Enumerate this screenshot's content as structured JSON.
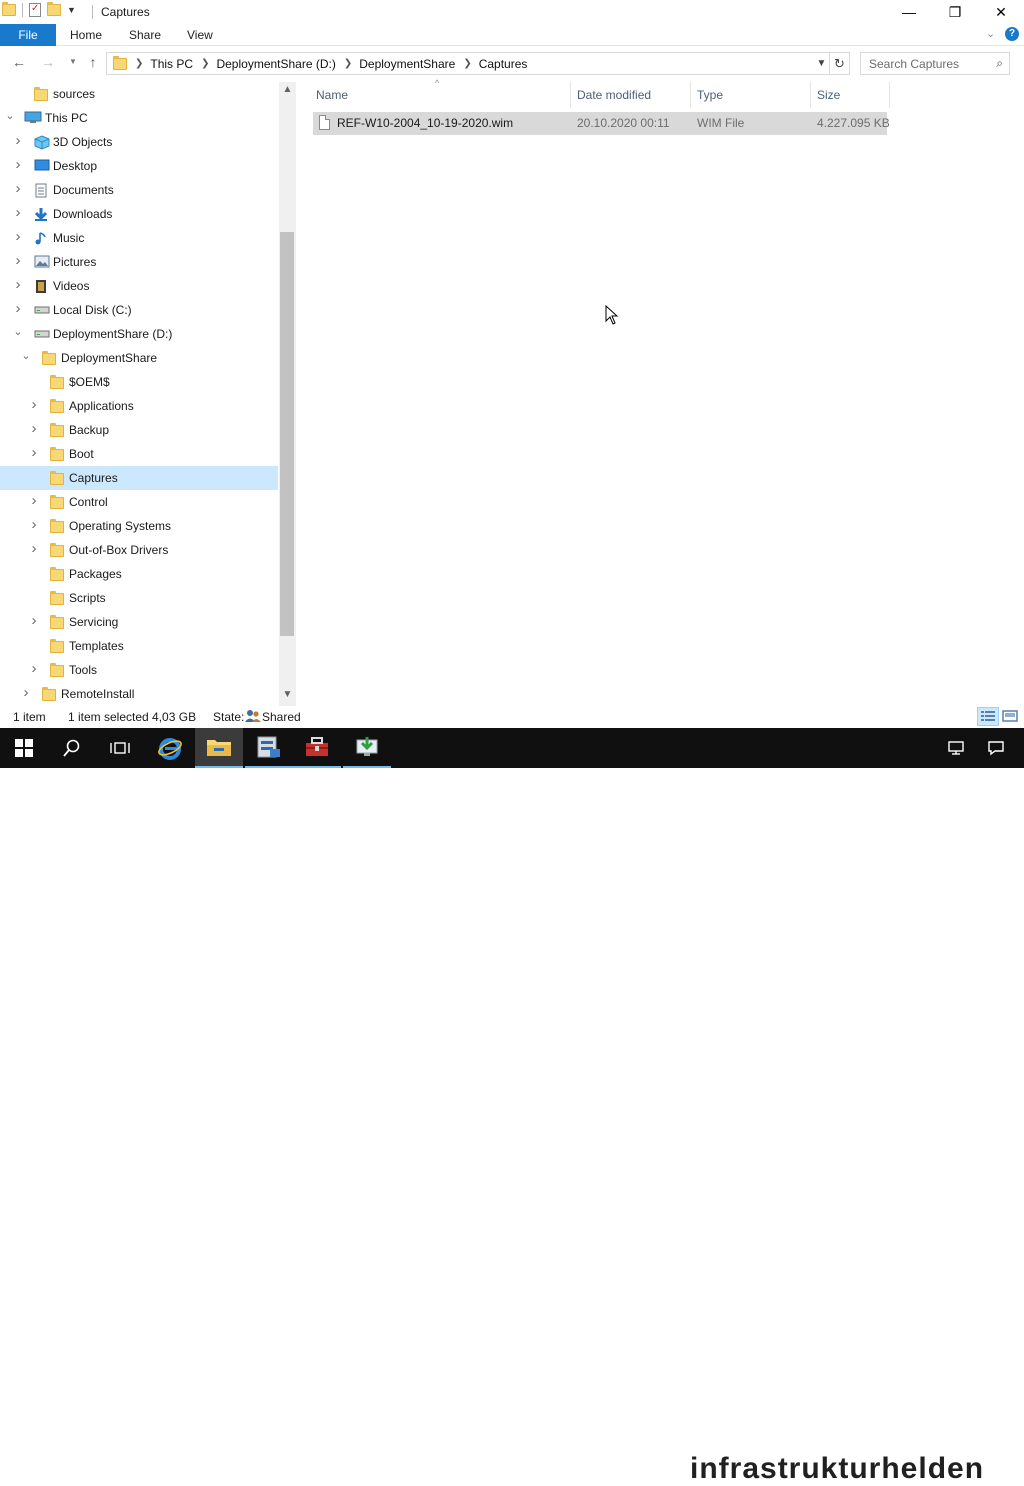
{
  "window": {
    "title": "Captures",
    "controls": {
      "minimize": "—",
      "maximize": "❐",
      "close": "✕"
    }
  },
  "ribbon": {
    "tabs": [
      "File",
      "Home",
      "Share",
      "View"
    ],
    "expand_icon": "chevron-down-icon",
    "help_icon": "help-icon"
  },
  "address": {
    "breadcrumb": [
      "This PC",
      "DeploymentShare (D:)",
      "DeploymentShare",
      "Captures"
    ]
  },
  "search": {
    "placeholder": "Search Captures"
  },
  "nav_tree": [
    {
      "label": "sources",
      "icon": "folder-icon",
      "level": 1,
      "chevron": ""
    },
    {
      "label": "This PC",
      "icon": "pc-icon",
      "level": 0,
      "chevron": "expanded"
    },
    {
      "label": "3D Objects",
      "icon": "3d-objects-icon",
      "level": 1,
      "chevron": "collapsed"
    },
    {
      "label": "Desktop",
      "icon": "desktop-icon",
      "level": 1,
      "chevron": "collapsed"
    },
    {
      "label": "Documents",
      "icon": "documents-icon",
      "level": 1,
      "chevron": "collapsed"
    },
    {
      "label": "Downloads",
      "icon": "downloads-icon",
      "level": 1,
      "chevron": "collapsed"
    },
    {
      "label": "Music",
      "icon": "music-icon",
      "level": 1,
      "chevron": "collapsed"
    },
    {
      "label": "Pictures",
      "icon": "pictures-icon",
      "level": 1,
      "chevron": "collapsed"
    },
    {
      "label": "Videos",
      "icon": "videos-icon",
      "level": 1,
      "chevron": "collapsed"
    },
    {
      "label": "Local Disk (C:)",
      "icon": "drive-icon",
      "level": 1,
      "chevron": "collapsed"
    },
    {
      "label": "DeploymentShare (D:)",
      "icon": "drive-icon",
      "level": 1,
      "chevron": "expanded"
    },
    {
      "label": "DeploymentShare",
      "icon": "folder-icon",
      "level": 2,
      "chevron": "expanded"
    },
    {
      "label": "$OEM$",
      "icon": "folder-icon",
      "level": 3,
      "chevron": ""
    },
    {
      "label": "Applications",
      "icon": "folder-icon",
      "level": 3,
      "chevron": "collapsed"
    },
    {
      "label": "Backup",
      "icon": "folder-icon",
      "level": 3,
      "chevron": "collapsed"
    },
    {
      "label": "Boot",
      "icon": "folder-icon",
      "level": 3,
      "chevron": "collapsed"
    },
    {
      "label": "Captures",
      "icon": "folder-icon",
      "level": 3,
      "chevron": "",
      "selected": true
    },
    {
      "label": "Control",
      "icon": "folder-icon",
      "level": 3,
      "chevron": "collapsed"
    },
    {
      "label": "Operating Systems",
      "icon": "folder-icon",
      "level": 3,
      "chevron": "collapsed"
    },
    {
      "label": "Out-of-Box Drivers",
      "icon": "folder-icon",
      "level": 3,
      "chevron": "collapsed"
    },
    {
      "label": "Packages",
      "icon": "folder-icon",
      "level": 3,
      "chevron": ""
    },
    {
      "label": "Scripts",
      "icon": "folder-icon",
      "level": 3,
      "chevron": ""
    },
    {
      "label": "Servicing",
      "icon": "folder-icon",
      "level": 3,
      "chevron": "collapsed"
    },
    {
      "label": "Templates",
      "icon": "folder-icon",
      "level": 3,
      "chevron": ""
    },
    {
      "label": "Tools",
      "icon": "folder-icon",
      "level": 3,
      "chevron": "collapsed"
    },
    {
      "label": "RemoteInstall",
      "icon": "folder-icon",
      "level": 2,
      "chevron": "collapsed"
    }
  ],
  "columns": [
    "Name",
    "Date modified",
    "Type",
    "Size"
  ],
  "files": [
    {
      "name": "REF-W10-2004_10-19-2020.wim",
      "date": "20.10.2020 00:11",
      "type": "WIM File",
      "size": "4.227.095 KB"
    }
  ],
  "status": {
    "count": "1 item",
    "selected": "1 item selected  4,03 GB",
    "state_label": "State:",
    "state_value": "Shared"
  },
  "taskbar": {
    "items": [
      "start-icon",
      "search-icon",
      "task-view-icon",
      "internet-explorer-icon",
      "file-explorer-icon",
      "server-manager-icon",
      "toolbox-icon",
      "deployment-workbench-icon"
    ]
  },
  "watermark": "infrastrukturhelden",
  "colors": {
    "accent": "#1979ca",
    "selection": "#cce8ff",
    "row_selected": "#d9d9d9"
  }
}
